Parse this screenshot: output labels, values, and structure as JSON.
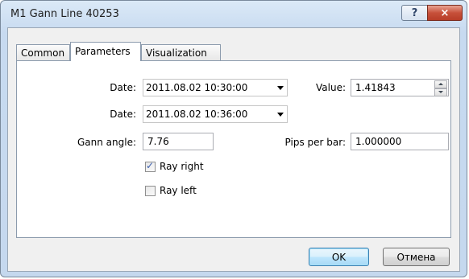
{
  "window": {
    "title": "M1 Gann Line 40253",
    "help_label": "?",
    "close_label": "×"
  },
  "tabs": [
    {
      "label": "Common"
    },
    {
      "label": "Parameters"
    },
    {
      "label": "Visualization"
    }
  ],
  "active_tab": "Parameters",
  "form": {
    "date1_label": "Date:",
    "date1_value": "2011.08.02 10:30:00",
    "date2_label": "Date:",
    "date2_value": "2011.08.02 10:36:00",
    "value_label": "Value:",
    "value_value": "1.41843",
    "gann_angle_label": "Gann angle:",
    "gann_angle_value": "7.76",
    "pips_per_bar_label": "Pips per bar:",
    "pips_per_bar_value": "1.000000",
    "ray_right_label": "Ray right",
    "ray_right_checked": true,
    "ray_left_label": "Ray left",
    "ray_left_checked": false
  },
  "buttons": {
    "ok_label": "OK",
    "cancel_label": "Отмена"
  }
}
